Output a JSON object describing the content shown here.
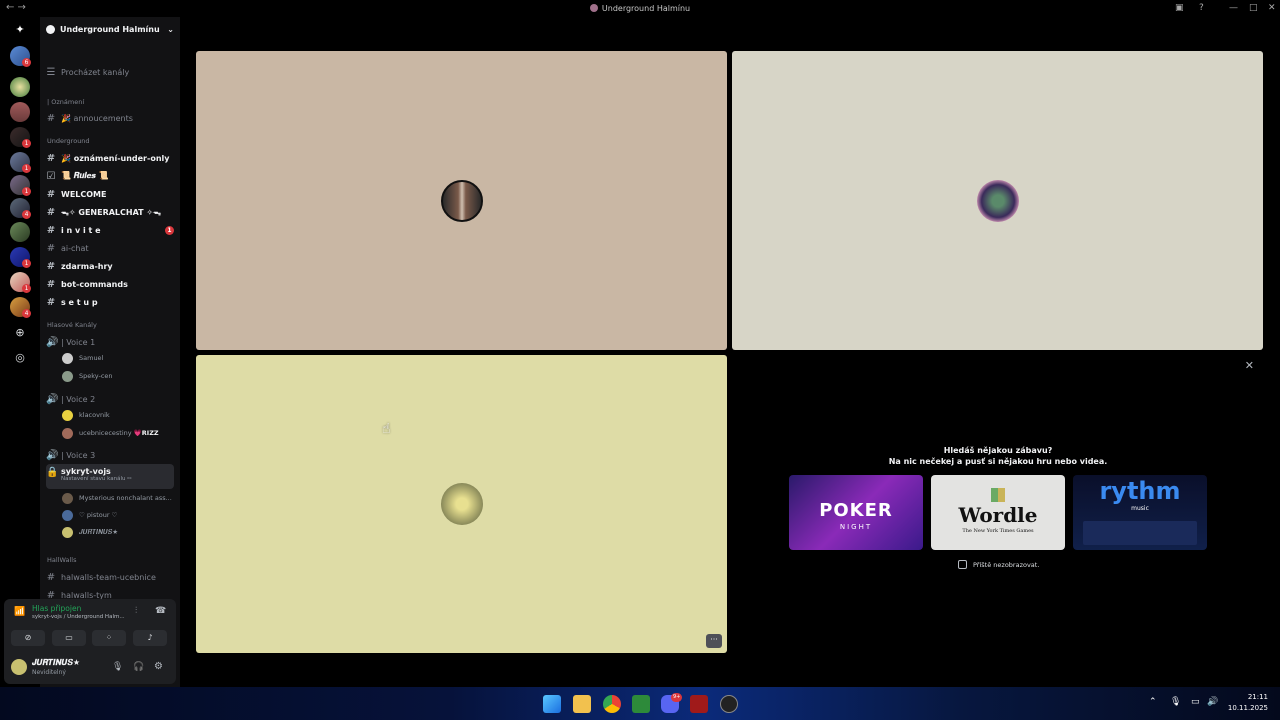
{
  "window": {
    "title": "Underground Halmínu"
  },
  "server": {
    "name": "Underground Halmínu"
  },
  "sidebar": {
    "browse_label": "Procházet kanály",
    "categories": {
      "announcements": "| Oznámení",
      "underground": "Underground",
      "voice": "Hlasové Kanály",
      "hallwalls": "HallWalls"
    },
    "channels": [
      {
        "label": "🎉 annoucements"
      },
      {
        "label": "🎉 oznámení-under-only"
      },
      {
        "label": "📜 𝑹𝒖𝒍𝒆𝒔 📜"
      },
      {
        "label": "WELCOME"
      },
      {
        "label": "ᯓ✧ GENERALCHAT ✧ᯓ"
      },
      {
        "label": "i n v i t e",
        "badge": "1"
      },
      {
        "label": "ai-chat"
      },
      {
        "label": "zdarma-hry"
      },
      {
        "label": "bot-commands"
      },
      {
        "label": "s e t u p"
      }
    ],
    "voice": [
      {
        "label": "| Voice 1",
        "users": [
          "Samuel",
          "Speky-cen"
        ]
      },
      {
        "label": "| Voice 2",
        "users": [
          "klacovnik",
          "ucebnicecestiny"
        ],
        "tag": "💗RIZZ"
      },
      {
        "label": "| Voice 3"
      },
      {
        "label": "sykryt-vojs",
        "status": "Nastavení stavu kanálu ✏",
        "users": [
          "Mysterious nonchalant ass...",
          "♡ pistour ♡",
          "𝑱𝑼𝑹𝑻𝑰𝑵𝑼𝑺★"
        ]
      }
    ],
    "hall_channels": [
      "halwalls-team-ucebnice",
      "halwalls-tym"
    ]
  },
  "voice_panel": {
    "status": "Hlas připojen",
    "channel": "sykryt-vojs / Underground Halm..."
  },
  "user_panel": {
    "name": "𝑱𝑼𝑹𝑻𝑰𝑵𝑼𝑺★",
    "status": "Neviditelný"
  },
  "promo": {
    "heading": "Hledáš nějakou zábavu?",
    "subheading": "Na nic nečekej a pusť si nějakou hru nebo videa.",
    "games": [
      "POKER",
      "NIGHT",
      "Wordle",
      "The New York Times Games",
      "rythm",
      "music"
    ],
    "checkbox_label": "Příště nezobrazovat."
  },
  "rail": {
    "badges": [
      "6",
      "1",
      "1",
      "1",
      "4",
      "1",
      "1",
      "4"
    ]
  },
  "taskbar": {
    "time": "21:11",
    "date": "10.11.2025",
    "discord_badge": "9+"
  },
  "colors": {
    "tile1": "#c9b7a4",
    "tile2": "#d7d5c7",
    "tile3": "#dedca6",
    "accent": "#23a559",
    "mention": "#da373c"
  }
}
